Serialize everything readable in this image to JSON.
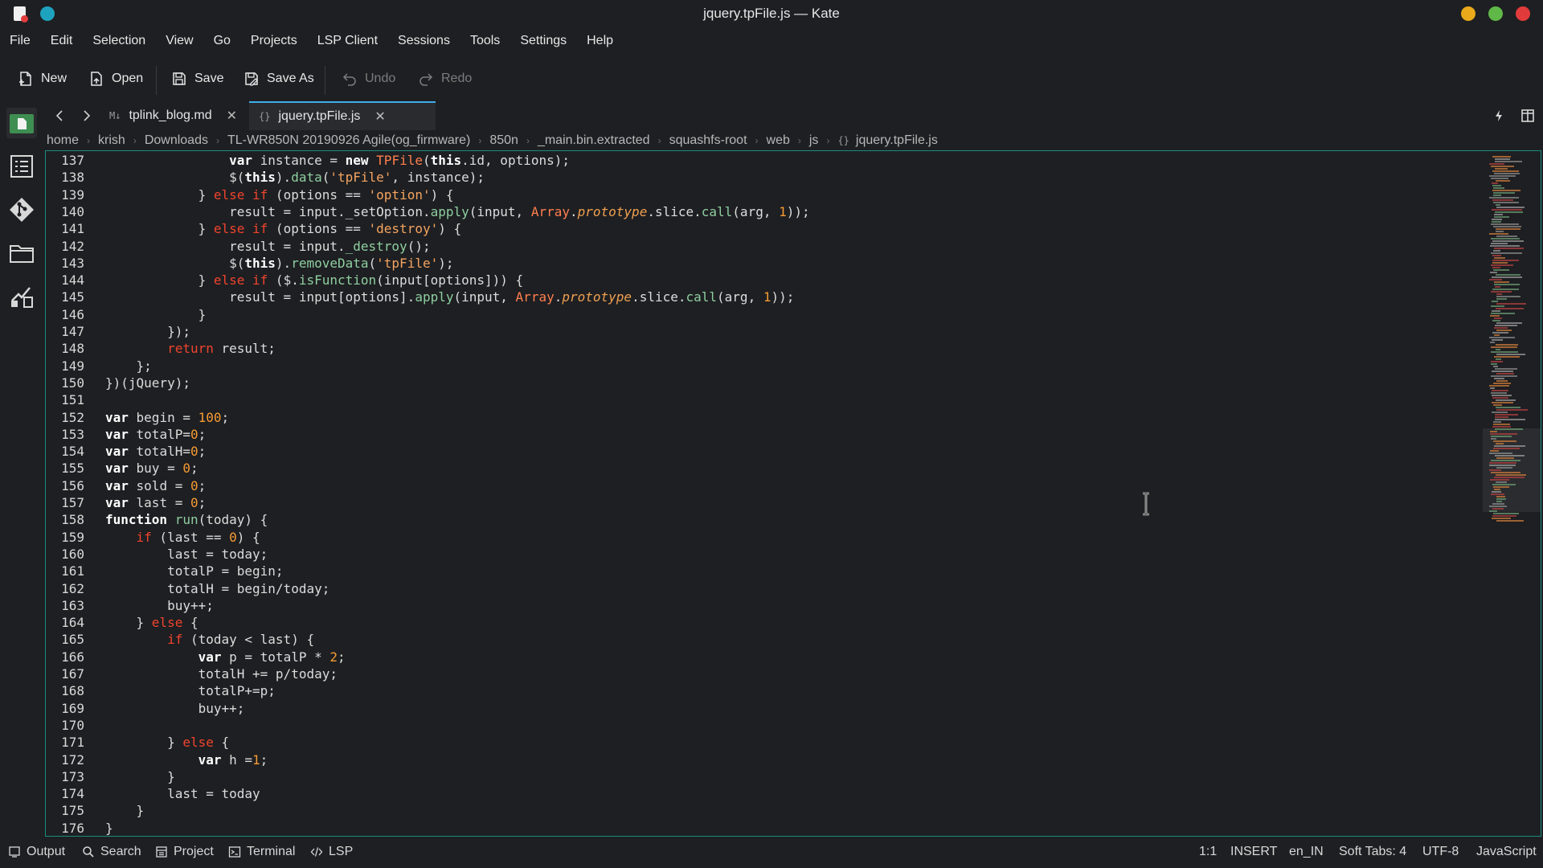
{
  "window": {
    "title": "jquery.tpFile.js — Kate"
  },
  "colors": {
    "accent": "#3daee9",
    "editor_border": "#1b8b7d",
    "minimize": "#e9a91a",
    "maximize": "#5fb848",
    "close": "#e23b3b"
  },
  "menu": [
    "File",
    "Edit",
    "Selection",
    "View",
    "Go",
    "Projects",
    "LSP Client",
    "Sessions",
    "Tools",
    "Settings",
    "Help"
  ],
  "toolbar": {
    "new": "New",
    "open": "Open",
    "save": "Save",
    "save_as": "Save As",
    "undo": "Undo",
    "redo": "Redo"
  },
  "left_panel_icons": [
    "documents-icon",
    "symbols-icon",
    "git-icon",
    "filesystem-icon",
    "outline-icon"
  ],
  "tabs": [
    {
      "label": "tplink_blog.md",
      "icon": "M↓",
      "active": false
    },
    {
      "label": "jquery.tpFile.js",
      "icon": "{}",
      "active": true
    }
  ],
  "breadcrumb": [
    "home",
    "krish",
    "Downloads",
    "TL-WR850N 20190926 Agile(og_firmware)",
    "850n",
    "_main.bin.extracted",
    "squashfs-root",
    "web",
    "js",
    "jquery.tpFile.js"
  ],
  "editor": {
    "first_line_number": 137,
    "lines": [
      "                var instance = new TPFile(this.id, options);",
      "                $(this).data('tpFile', instance);",
      "            } else if (options == 'option') {",
      "                result = input._setOption.apply(input, Array.prototype.slice.call(arg, 1));",
      "            } else if (options == 'destroy') {",
      "                result = input._destroy();",
      "                $(this).removeData('tpFile');",
      "            } else if ($.isFunction(input[options])) {",
      "                result = input[options].apply(input, Array.prototype.slice.call(arg, 1));",
      "            }",
      "        });",
      "        return result;",
      "    };",
      "})(jQuery);",
      "",
      "var begin = 100;",
      "var totalP=0;",
      "var totalH=0;",
      "var buy = 0;",
      "var sold = 0;",
      "var last = 0;",
      "function run(today) {",
      "    if (last == 0) {",
      "        last = today;",
      "        totalP = begin;",
      "        totalH = begin/today;",
      "        buy++;",
      "    } else {",
      "        if (today < last) {",
      "            var p = totalP * 2;",
      "            totalH += p/today;",
      "            totalP+=p;",
      "            buy++;",
      "",
      "        } else {",
      "            var h =1;",
      "        }",
      "        last = today",
      "    }",
      "}"
    ]
  },
  "statusbar": {
    "left": [
      "Output",
      "Search",
      "Project",
      "Terminal",
      "LSP"
    ],
    "cursor": "1:1",
    "mode": "INSERT",
    "language_dict": "en_IN",
    "indent": "Soft Tabs: 4",
    "encoding": "UTF-8",
    "syntax": "JavaScript"
  }
}
